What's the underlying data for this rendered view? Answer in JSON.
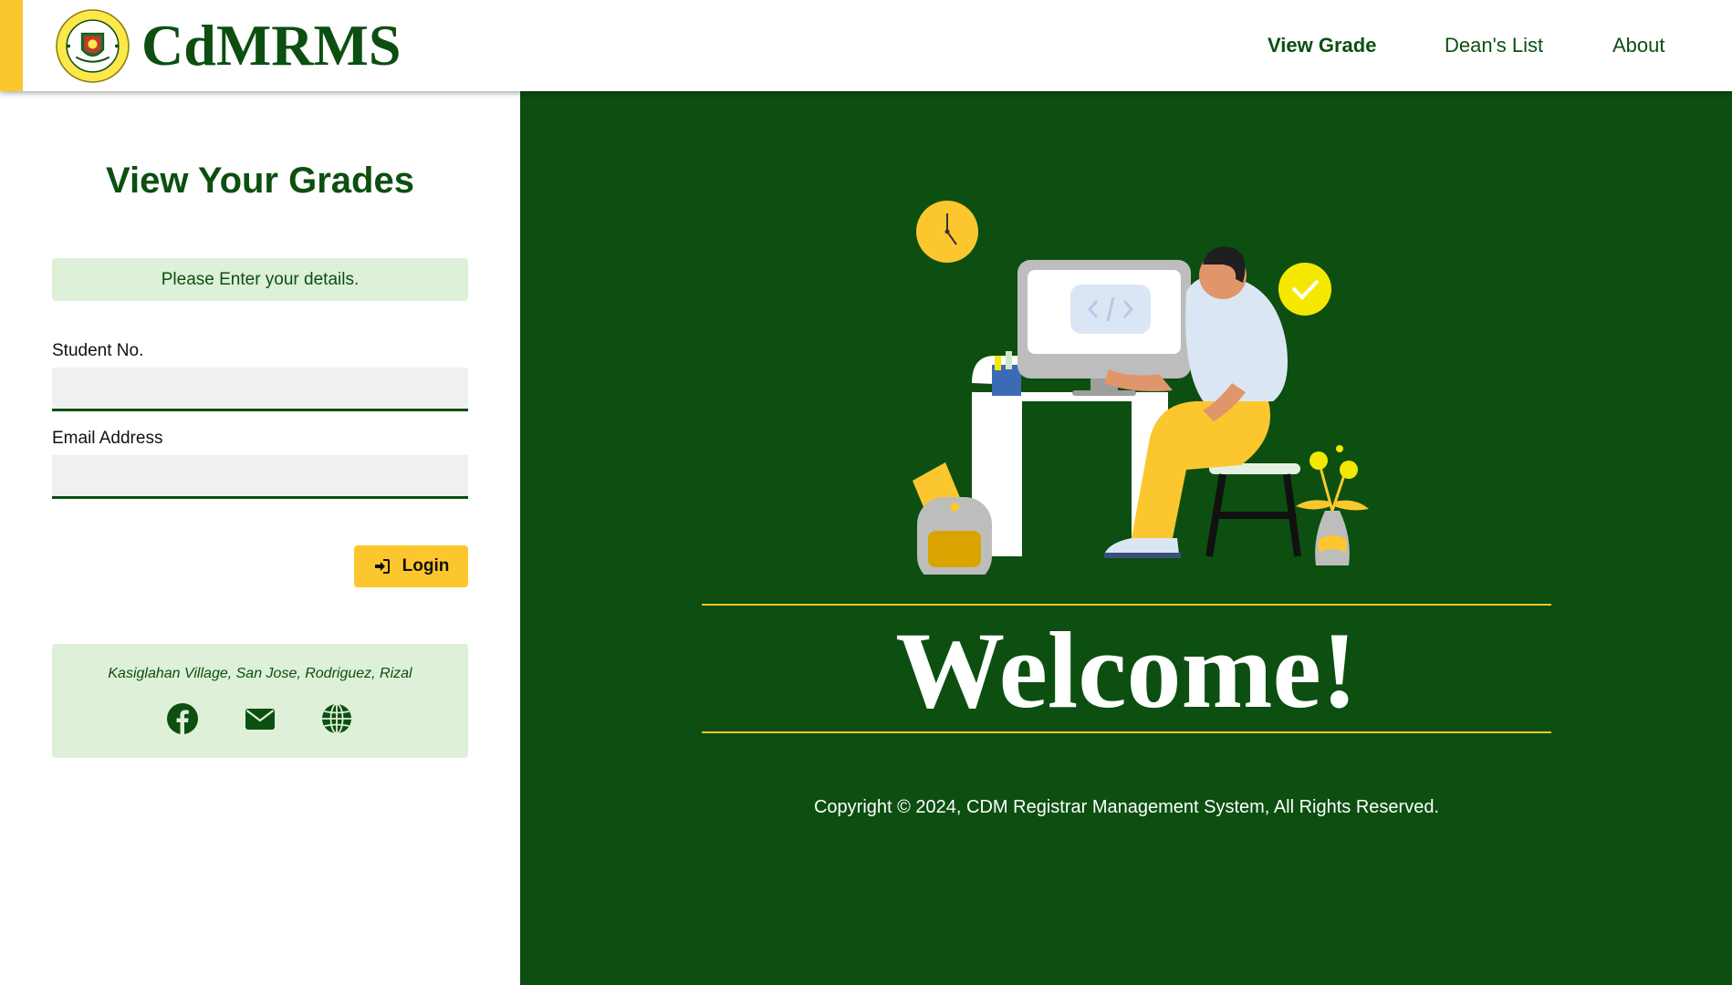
{
  "header": {
    "brand": "CdMRMS",
    "logo_text_top": "COLEGIO DE MONTALBAN",
    "logo_text_bottom": "RODRIGUEZ RIZAL",
    "nav": [
      {
        "label": "View Grade",
        "active": true
      },
      {
        "label": "Dean's List",
        "active": false
      },
      {
        "label": "About",
        "active": false
      }
    ]
  },
  "form": {
    "title": "View Your Grades",
    "notice": "Please Enter your details.",
    "student_label": "Student No.",
    "student_value": "",
    "email_label": "Email Address",
    "email_value": "",
    "login_label": "Login",
    "login_icon": "sign-in-icon"
  },
  "info": {
    "address": "Kasiglahan Village, San Jose, Rodriguez, Rizal",
    "social_icons": [
      "facebook-icon",
      "envelope-icon",
      "globe-icon"
    ]
  },
  "hero": {
    "welcome": "Welcome!",
    "copyright": "Copyright © 2024, CDM Registrar Management System, All Rights Reserved."
  },
  "colors": {
    "brand_green": "#0c4f11",
    "accent_yellow": "#fcc72e",
    "light_green": "#def0d8"
  }
}
